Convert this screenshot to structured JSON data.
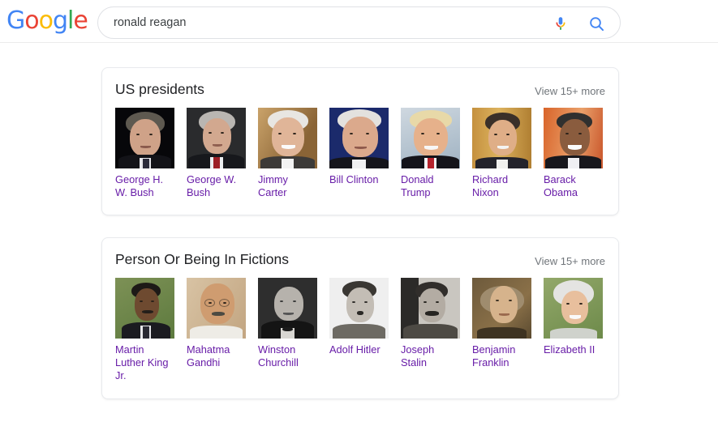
{
  "brand": {
    "logo_text": "Google",
    "letters": [
      "G",
      "o",
      "o",
      "g",
      "l",
      "e"
    ],
    "colors": {
      "blue": "#4285f4",
      "red": "#ea4335",
      "yellow": "#fbbc05",
      "green": "#34a853",
      "link_visited": "#681da8",
      "text_grey": "#70757a",
      "title_dark": "#202124"
    }
  },
  "search": {
    "value": "ronald reagan",
    "placeholder": "Search",
    "mic_icon": "microphone-icon",
    "search_icon": "search-icon"
  },
  "cards": [
    {
      "id": "us-presidents",
      "title": "US presidents",
      "more_label": "View 15+ more",
      "items": [
        {
          "name": "George H.\nW. Bush",
          "label": "George H. W. Bush"
        },
        {
          "name": "George W.\nBush",
          "label": "George W. Bush"
        },
        {
          "name": "Jimmy\nCarter",
          "label": "Jimmy Carter"
        },
        {
          "name": "Bill Clinton",
          "label": "Bill Clinton"
        },
        {
          "name": "Donald\nTrump",
          "label": "Donald Trump"
        },
        {
          "name": "Richard\nNixon",
          "label": "Richard Nixon"
        },
        {
          "name": "Barack\nObama",
          "label": "Barack Obama"
        }
      ]
    },
    {
      "id": "person-or-being-in-fictions",
      "title": "Person Or Being In Fictions",
      "more_label": "View 15+ more",
      "items": [
        {
          "name": "Martin\nLuther King\nJr.",
          "label": "Martin Luther King Jr."
        },
        {
          "name": "Mahatma\nGandhi",
          "label": "Mahatma Gandhi"
        },
        {
          "name": "Winston\nChurchill",
          "label": "Winston Churchill"
        },
        {
          "name": "Adolf Hitler",
          "label": "Adolf Hitler"
        },
        {
          "name": "Joseph\nStalin",
          "label": "Joseph Stalin"
        },
        {
          "name": "Benjamin\nFranklin",
          "label": "Benjamin Franklin"
        },
        {
          "name": "Elizabeth II",
          "label": "Elizabeth II"
        }
      ]
    }
  ]
}
